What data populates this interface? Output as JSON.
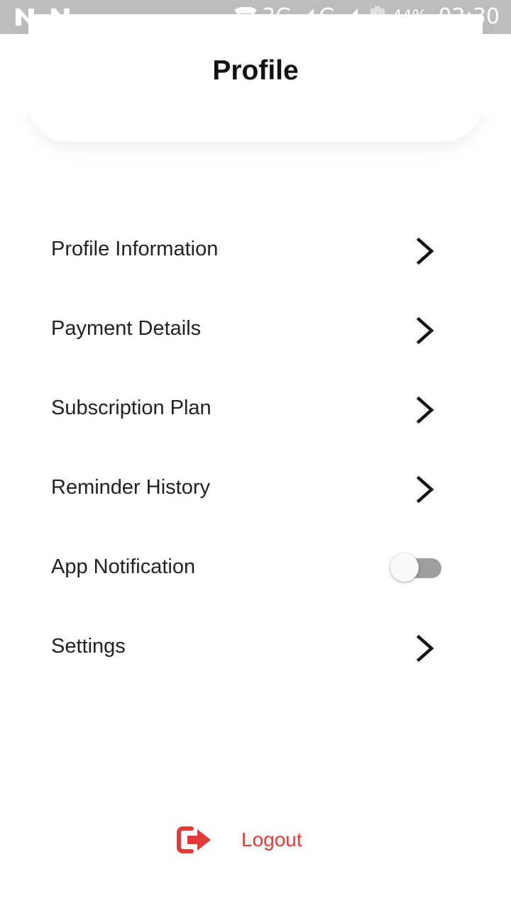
{
  "status_bar": {
    "network_3g": "3G",
    "network_g": "G",
    "battery_pct": "44%",
    "time": "02:30",
    "icons": [
      "n-notification-icon",
      "n-notification-icon",
      "wifi-icon",
      "signal-icon",
      "signal-icon",
      "battery-icon"
    ]
  },
  "header": {
    "title": "Profile"
  },
  "menu": {
    "items": [
      {
        "label": "Profile Information",
        "control": "chevron"
      },
      {
        "label": "Payment Details",
        "control": "chevron"
      },
      {
        "label": "Subscription Plan",
        "control": "chevron"
      },
      {
        "label": "Reminder History",
        "control": "chevron"
      },
      {
        "label": "App Notification",
        "control": "toggle",
        "toggle_on": false
      },
      {
        "label": "Settings",
        "control": "chevron"
      }
    ]
  },
  "logout": {
    "label": "Logout",
    "icon": "logout-icon",
    "color": "#e53935"
  }
}
